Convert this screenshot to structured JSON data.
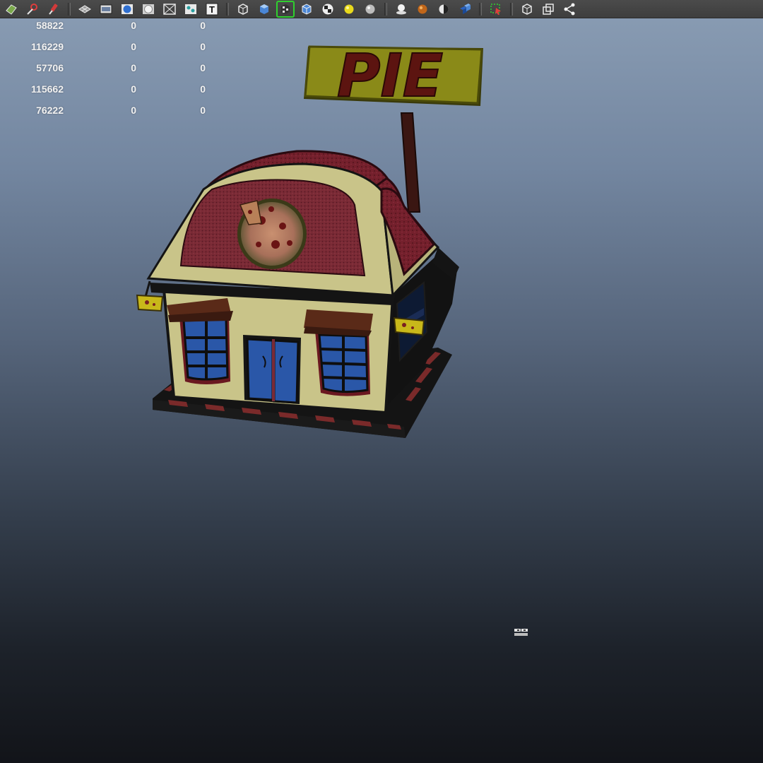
{
  "toolbar": {
    "buttons": [
      {
        "icon": "select-tool-icon"
      },
      {
        "icon": "lasso-tool-icon"
      },
      {
        "icon": "paint-tool-icon"
      },
      {
        "separator": true
      },
      {
        "icon": "grid-icon"
      },
      {
        "icon": "film-gate-icon"
      },
      {
        "icon": "resolution-gate-icon"
      },
      {
        "icon": "safe-frame-icon"
      },
      {
        "icon": "field-chart-icon"
      },
      {
        "icon": "camera-icon"
      },
      {
        "icon": "text-icon",
        "label": "T"
      },
      {
        "separator": true
      },
      {
        "icon": "wireframe-icon"
      },
      {
        "icon": "smooth-shade-icon"
      },
      {
        "icon": "textured-icon",
        "active": true
      },
      {
        "icon": "wireframe-on-shaded-icon"
      },
      {
        "icon": "checker-icon"
      },
      {
        "icon": "default-light-icon"
      },
      {
        "icon": "all-lights-icon"
      },
      {
        "separator": true
      },
      {
        "icon": "shadows-icon"
      },
      {
        "icon": "ambient-occlusion-icon"
      },
      {
        "icon": "motion-blur-icon"
      },
      {
        "icon": "anti-alias-icon"
      },
      {
        "separator": true
      },
      {
        "icon": "isolate-select-icon"
      },
      {
        "separator": true
      },
      {
        "icon": "xray-icon"
      },
      {
        "icon": "xray-joints-icon"
      },
      {
        "icon": "xray-components-icon"
      }
    ]
  },
  "hud": {
    "rows": [
      {
        "a": "58822",
        "b": "0",
        "c": "0"
      },
      {
        "a": "116229",
        "b": "0",
        "c": "0"
      },
      {
        "a": "57706",
        "b": "0",
        "c": "0"
      },
      {
        "a": "115662",
        "b": "0",
        "c": "0"
      },
      {
        "a": "76222",
        "b": "0",
        "c": "0"
      }
    ]
  },
  "scene": {
    "sign_text": "PIE",
    "colors": {
      "sign_board": "#8a8a18",
      "sign_text": "#5c1410",
      "wall": "#c9c489",
      "roof": "#6e1e28",
      "window": "#2a57a8",
      "dark": "#141414"
    }
  }
}
